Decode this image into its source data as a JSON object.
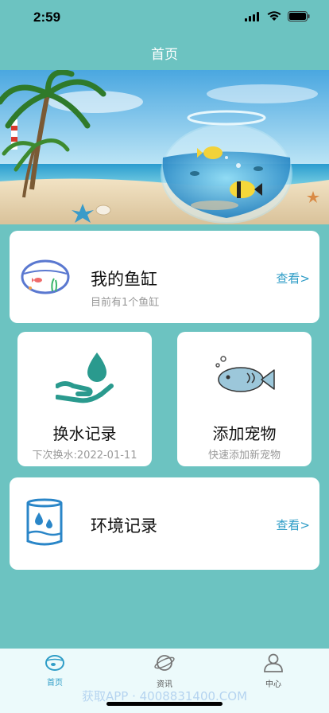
{
  "status": {
    "time": "2:59"
  },
  "header": {
    "title": "首页"
  },
  "cards": {
    "aquarium": {
      "title": "我的鱼缸",
      "subtitle": "目前有1个鱼缸",
      "link": "查看>"
    },
    "water_change": {
      "title": "换水记录",
      "subtitle": "下次换水:2022-01-11"
    },
    "add_pet": {
      "title": "添加宠物",
      "subtitle": "快速添加新宠物"
    },
    "environment": {
      "title": "环境记录",
      "link": "查看>"
    }
  },
  "tabbar": {
    "items": [
      {
        "label": "首页",
        "icon": "fish-bowl-icon",
        "active": true
      },
      {
        "label": "资讯",
        "icon": "planet-icon",
        "active": false
      },
      {
        "label": "中心",
        "icon": "user-icon",
        "active": false
      }
    ]
  },
  "watermark": "获取APP · 4008831400.COM",
  "colors": {
    "background": "#6cc3c1",
    "accent": "#2f9dc7",
    "tabbar": "#ecfafb"
  }
}
